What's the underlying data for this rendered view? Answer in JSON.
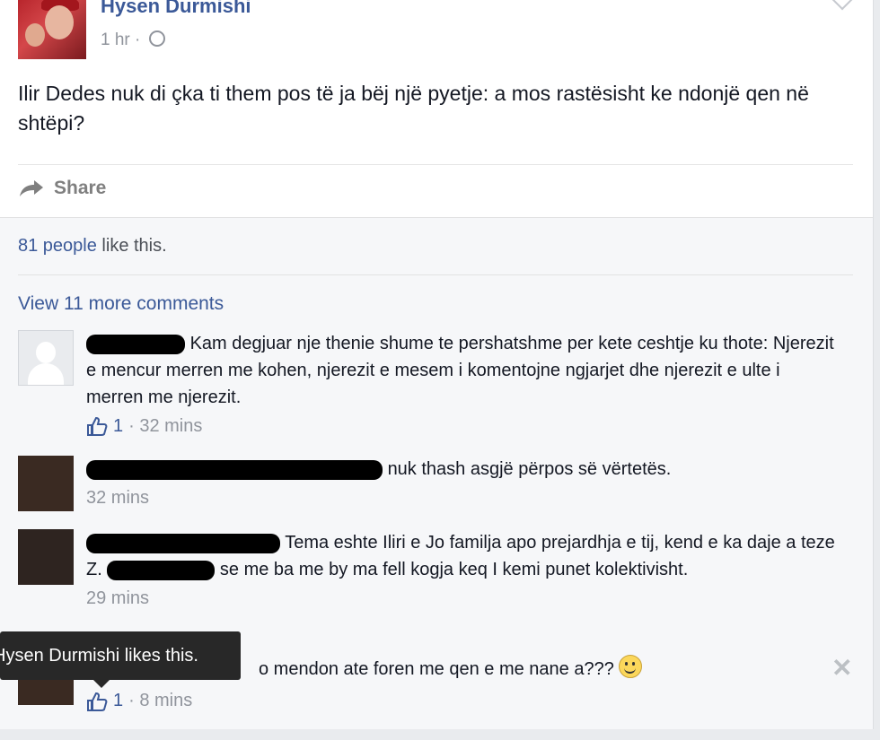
{
  "post": {
    "author": "Hysen Durmishi",
    "time": "1 hr ·",
    "text": "Ilir Dedes nuk di çka ti them pos të ja bëj një pyetje: a mos rastësisht ke ndonjë qen në shtëpi?",
    "share_label": "Share"
  },
  "likes": {
    "count_link": "81 people",
    "suffix": " like this."
  },
  "view_more": "View 11 more comments",
  "comments": [
    {
      "text": "Kam degjuar nje thenie shume te pershatshme per kete ceshtje ku thote: Njerezit e mencur merren me kohen, njerezit e mesem i komentojne ngjarjet dhe njerezit e ulte i merren me njerezit.",
      "likes": "1",
      "time": "· 32 mins"
    },
    {
      "text": "nuk thash asgjë përpos së vërtetës.",
      "time": "32 mins"
    },
    {
      "text_a": "Tema eshte Iliri e Jo familja apo prejardhja e tij, kend e ka daje a teze Z.",
      "text_b": "se me ba me by ma fell kogja keq I kemi punet kolektivisht.",
      "time": "29 mins"
    },
    {
      "text": "o mendon ate foren me qen e me nane a???",
      "likes": "1",
      "time": "· 8 mins"
    }
  ],
  "tooltip": "Hysen Durmishi likes this.",
  "close_symbol": "✕"
}
